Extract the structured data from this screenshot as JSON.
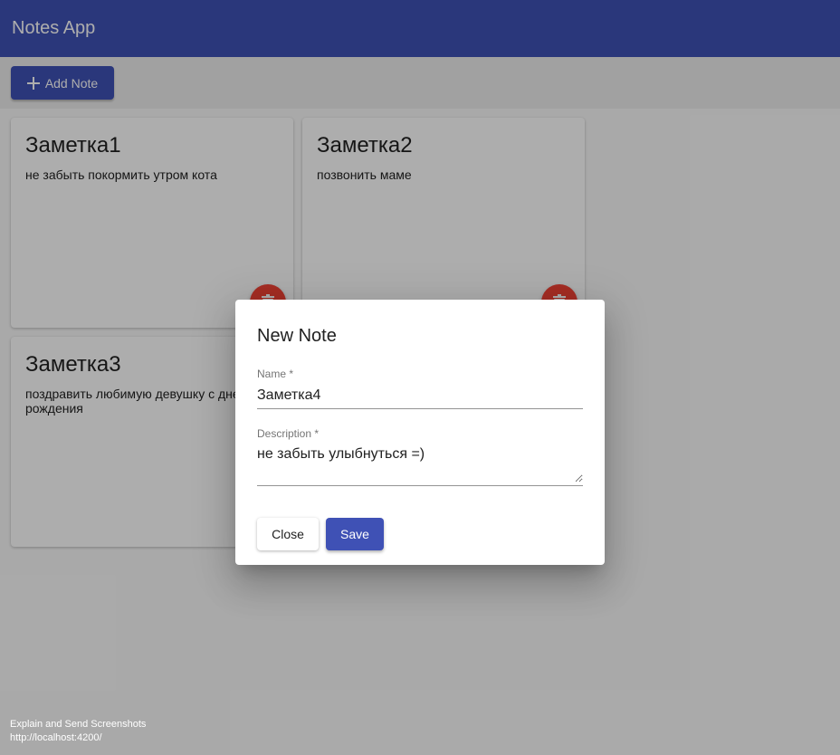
{
  "app": {
    "title": "Notes App"
  },
  "actions": {
    "add_note_label": "Add Note",
    "add_icon": "plus-icon"
  },
  "notes": [
    {
      "title": "Заметка1",
      "text": "не забыть покормить утром кота"
    },
    {
      "title": "Заметка2",
      "text": "позвонить маме"
    },
    {
      "title": "Заметка3",
      "text": "поздравить любимую девушку с днем рождения"
    }
  ],
  "colors": {
    "primary": "#3f51b5",
    "delete": "#f44336"
  },
  "dialog": {
    "title": "New Note",
    "name_label": "Name *",
    "name_value": "Заметка4",
    "description_label": "Description *",
    "description_value": "не забыть улыбнуться =)",
    "close_label": "Close",
    "save_label": "Save"
  },
  "footer": {
    "line1": "Explain and Send Screenshots",
    "line2": "http://localhost:4200/"
  }
}
